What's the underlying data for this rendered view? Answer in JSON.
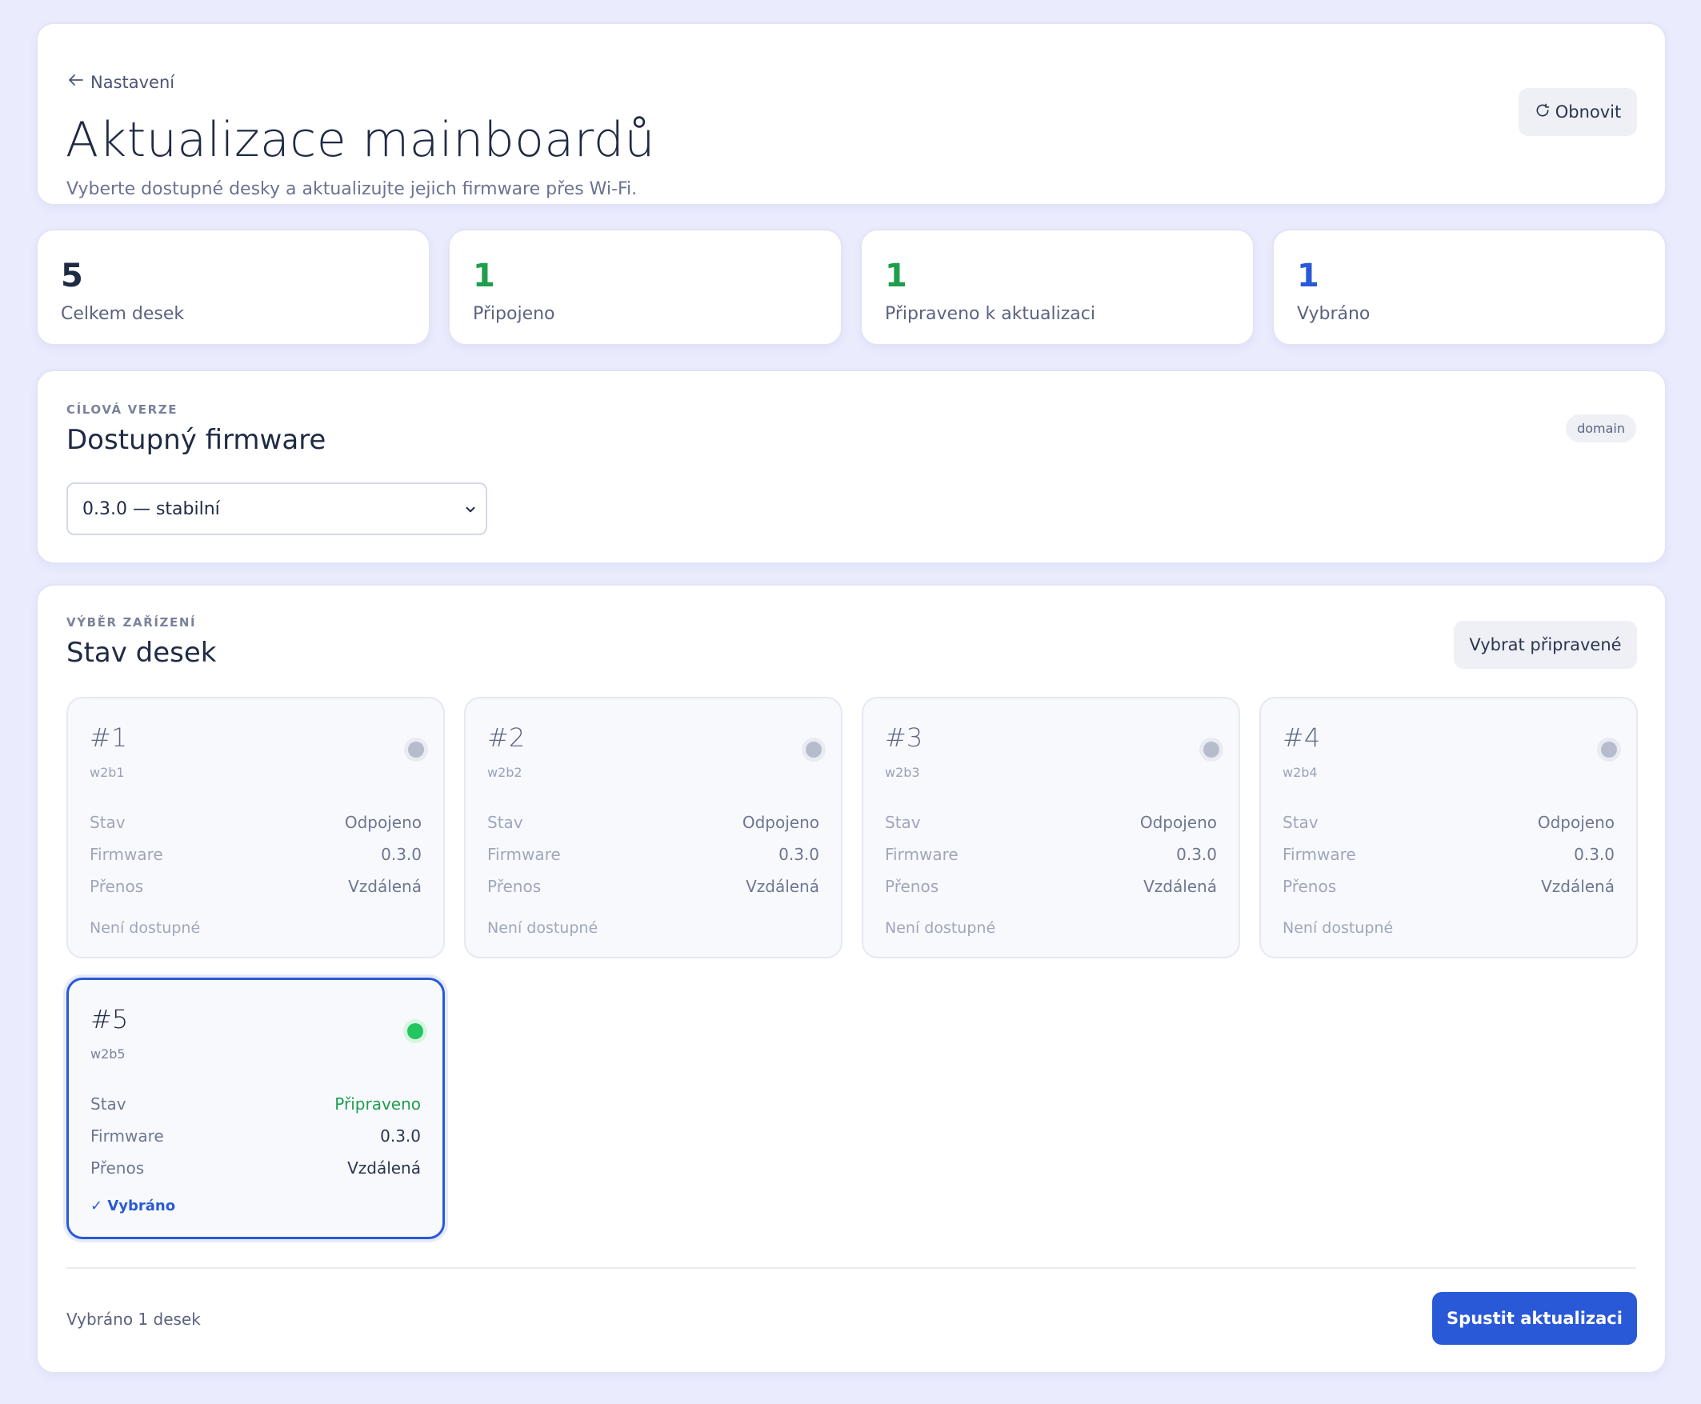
{
  "header": {
    "back_label": "Nastavení",
    "title": "Aktualizace mainboardů",
    "subtitle": "Vyberte dostupné desky a aktualizujte jejich firmware přes Wi-Fi.",
    "refresh_label": "Obnovit"
  },
  "stats": [
    {
      "value": "5",
      "label": "Celkem desek",
      "color": "#1f2a44"
    },
    {
      "value": "1",
      "label": "Připojeno",
      "color": "#1e9e4e"
    },
    {
      "value": "1",
      "label": "Připraveno k aktualizaci",
      "color": "#1e9e4e"
    },
    {
      "value": "1",
      "label": "Vybráno",
      "color": "#2a59d8"
    }
  ],
  "firmware": {
    "eyebrow": "CÍLOVÁ VERZE",
    "title": "Dostupný firmware",
    "badge": "domain",
    "selected_option": "0.3.0 — stabilní"
  },
  "devices": {
    "eyebrow": "VÝBĚR ZAŘÍZENÍ",
    "title": "Stav desek",
    "select_ready_label": "Vybrat připravené",
    "row_labels": {
      "status": "Stav",
      "firmware": "Firmware",
      "transfer": "Přenos"
    },
    "boards": [
      {
        "num": "#1",
        "id": "w2b1",
        "status": "Odpojeno",
        "firmware": "0.3.0",
        "transfer": "Vzdálená",
        "footer": "Není dostupné",
        "online": false,
        "selected": false
      },
      {
        "num": "#2",
        "id": "w2b2",
        "status": "Odpojeno",
        "firmware": "0.3.0",
        "transfer": "Vzdálená",
        "footer": "Není dostupné",
        "online": false,
        "selected": false
      },
      {
        "num": "#3",
        "id": "w2b3",
        "status": "Odpojeno",
        "firmware": "0.3.0",
        "transfer": "Vzdálená",
        "footer": "Není dostupné",
        "online": false,
        "selected": false
      },
      {
        "num": "#4",
        "id": "w2b4",
        "status": "Odpojeno",
        "firmware": "0.3.0",
        "transfer": "Vzdálená",
        "footer": "Není dostupné",
        "online": false,
        "selected": false
      },
      {
        "num": "#5",
        "id": "w2b5",
        "status": "Připraveno",
        "firmware": "0.3.0",
        "transfer": "Vzdálená",
        "footer": "✓ Vybráno",
        "online": true,
        "selected": true
      }
    ],
    "selected_count_text": "Vybráno 1 desek",
    "start_label": "Spustit aktualizaci"
  }
}
